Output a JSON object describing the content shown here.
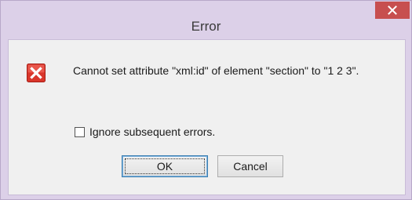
{
  "dialog": {
    "title": "Error",
    "message": "Cannot set attribute \"xml:id\" of element \"section\" to \"1 2 3\".",
    "checkbox": {
      "label": "Ignore subsequent errors.",
      "checked": false
    },
    "buttons": {
      "ok_label": "OK",
      "cancel_label": "Cancel"
    },
    "icons": {
      "close": "close-icon",
      "error": "error-icon"
    },
    "colors": {
      "frame": "#dcd0e8",
      "close_button": "#c74f4f",
      "error_icon": "#d9362b",
      "client_background": "#f0f0f0"
    }
  }
}
